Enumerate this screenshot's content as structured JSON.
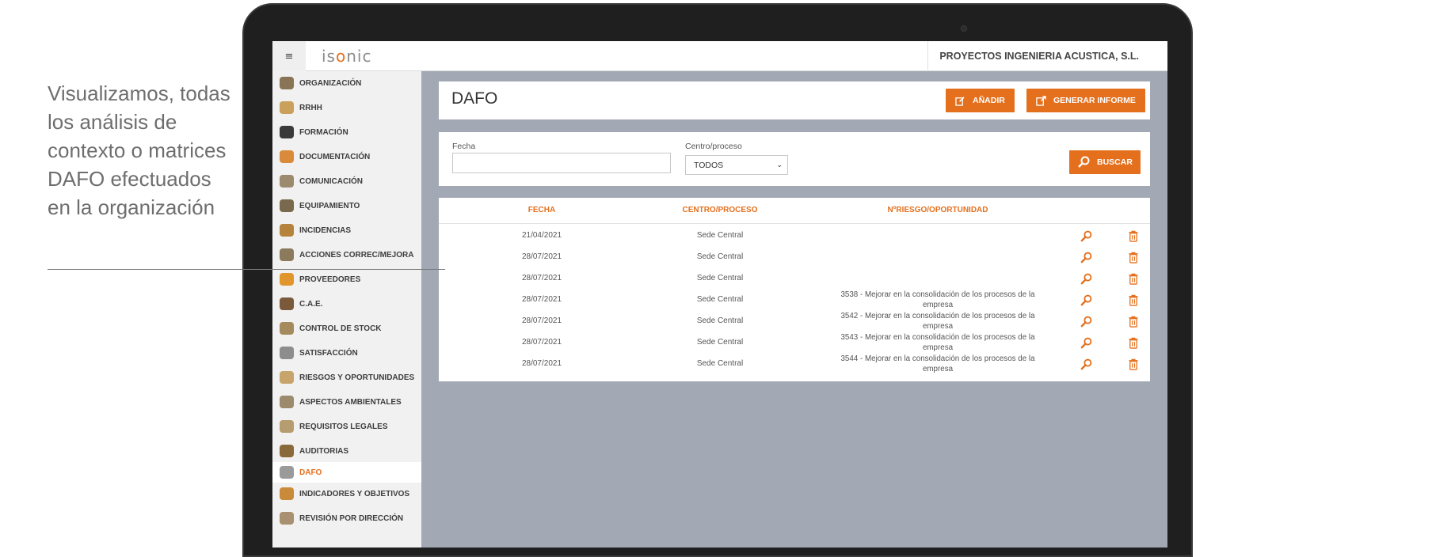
{
  "caption": {
    "text": "Visualizamos, todas los análisis de contexto o matrices DAFO efectuados en la organización"
  },
  "topbar": {
    "menu_icon": "≡",
    "logo_parts": [
      "is",
      "o",
      "nic"
    ],
    "company": "PROYECTOS INGENIERIA ACUSTICA, S.L."
  },
  "sidebar": {
    "items": [
      {
        "label": "ORGANIZACIÓN",
        "icon": "building-icon",
        "color": "#8a7456"
      },
      {
        "label": "RRHH",
        "icon": "people-icon",
        "color": "#c9a15c"
      },
      {
        "label": "FORMACIÓN",
        "icon": "graduation-cap-icon",
        "color": "#3a3a3a"
      },
      {
        "label": "DOCUMENTACIÓN",
        "icon": "folder-icon",
        "color": "#d98a3a"
      },
      {
        "label": "COMUNICACIÓN",
        "icon": "notepad-icon",
        "color": "#9b8a6d"
      },
      {
        "label": "EQUIPAMIENTO",
        "icon": "tools-icon",
        "color": "#7a6a4d"
      },
      {
        "label": "INCIDENCIAS",
        "icon": "warning-icon",
        "color": "#b5833c"
      },
      {
        "label": "ACCIONES CORREC/MEJORA",
        "icon": "wrench-icon",
        "color": "#8c7a5d"
      },
      {
        "label": "PROVEEDORES",
        "icon": "box-icon",
        "color": "#e0962c"
      },
      {
        "label": "C.A.E.",
        "icon": "briefcase-icon",
        "color": "#7a5a3a"
      },
      {
        "label": "CONTROL DE STOCK",
        "icon": "list-icon",
        "color": "#a58a5d"
      },
      {
        "label": "SATISFACCIÓN",
        "icon": "gears-icon",
        "color": "#8d8d8d"
      },
      {
        "label": "RIESGOS Y OPORTUNIDADES",
        "icon": "clipboard-icon",
        "color": "#c7a46b"
      },
      {
        "label": "ASPECTOS AMBIENTALES",
        "icon": "leaf-icon",
        "color": "#9c8a6c"
      },
      {
        "label": "REQUISITOS LEGALES",
        "icon": "book-icon",
        "color": "#b79c70"
      },
      {
        "label": "AUDITORIAS",
        "icon": "audit-icon",
        "color": "#8a6a3a"
      },
      {
        "label": "DAFO",
        "icon": "dafo-icon",
        "color": "#9a9a9a"
      },
      {
        "label": "INDICADORES Y OBJETIVOS",
        "icon": "chart-icon",
        "color": "#c98a3a"
      },
      {
        "label": "REVISIÓN POR DIRECCIÓN",
        "icon": "review-icon",
        "color": "#a89070"
      }
    ],
    "active": "DAFO"
  },
  "header": {
    "title": "DAFO",
    "add_label": "AÑADIR",
    "report_label": "GENERAR INFORME"
  },
  "filters": {
    "fecha_label": "Fecha",
    "fecha_value": "",
    "centro_label": "Centro/proceso",
    "centro_value": "TODOS",
    "search_label": "BUSCAR"
  },
  "table": {
    "columns": [
      "FECHA",
      "CENTRO/PROCESO",
      "NºRIESGO/OPORTUNIDAD"
    ],
    "rows": [
      {
        "fecha": "21/04/2021",
        "centro": "Sede Central",
        "riesgo_1": "",
        "riesgo_2": ""
      },
      {
        "fecha": "28/07/2021",
        "centro": "Sede Central",
        "riesgo_1": "",
        "riesgo_2": ""
      },
      {
        "fecha": "28/07/2021",
        "centro": "Sede Central",
        "riesgo_1": "",
        "riesgo_2": ""
      },
      {
        "fecha": "28/07/2021",
        "centro": "Sede Central",
        "riesgo_1": "3538 - Mejorar en la consolidación de los procesos de la",
        "riesgo_2": "empresa"
      },
      {
        "fecha": "28/07/2021",
        "centro": "Sede Central",
        "riesgo_1": "3542 - Mejorar en la consolidación de los procesos de la",
        "riesgo_2": "empresa"
      },
      {
        "fecha": "28/07/2021",
        "centro": "Sede Central",
        "riesgo_1": "3543 - Mejorar en la consolidación de los procesos de la",
        "riesgo_2": "empresa"
      },
      {
        "fecha": "28/07/2021",
        "centro": "Sede Central",
        "riesgo_1": "3544 - Mejorar en la consolidación de los procesos de la",
        "riesgo_2": "empresa"
      }
    ]
  },
  "colors": {
    "accent": "#e4701e",
    "screen_bg": "#a3a9b4",
    "sidebar_bg": "#f1f1f1"
  }
}
